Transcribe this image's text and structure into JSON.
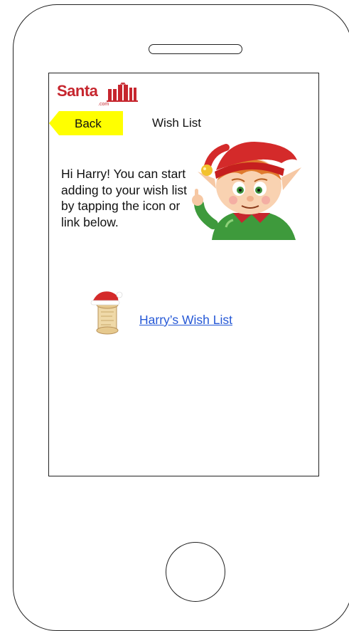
{
  "app": {
    "logo_text": "Santa",
    "logo_sub": ".com"
  },
  "header": {
    "back_label": "Back",
    "title": "Wish List"
  },
  "main": {
    "intro_text": "Hi Harry! You can start adding to your wish list by tapping the icon or link below.",
    "wishlist_link": "Harry’s Wish List"
  },
  "colors": {
    "back_button": "#ffff00",
    "brand_red": "#c6262e",
    "link": "#2558d6"
  },
  "icons": {
    "logo_gifts": "gift-boxes-icon",
    "elf": "elf-illustration",
    "wishlist": "scroll-with-santa-hat-icon"
  }
}
